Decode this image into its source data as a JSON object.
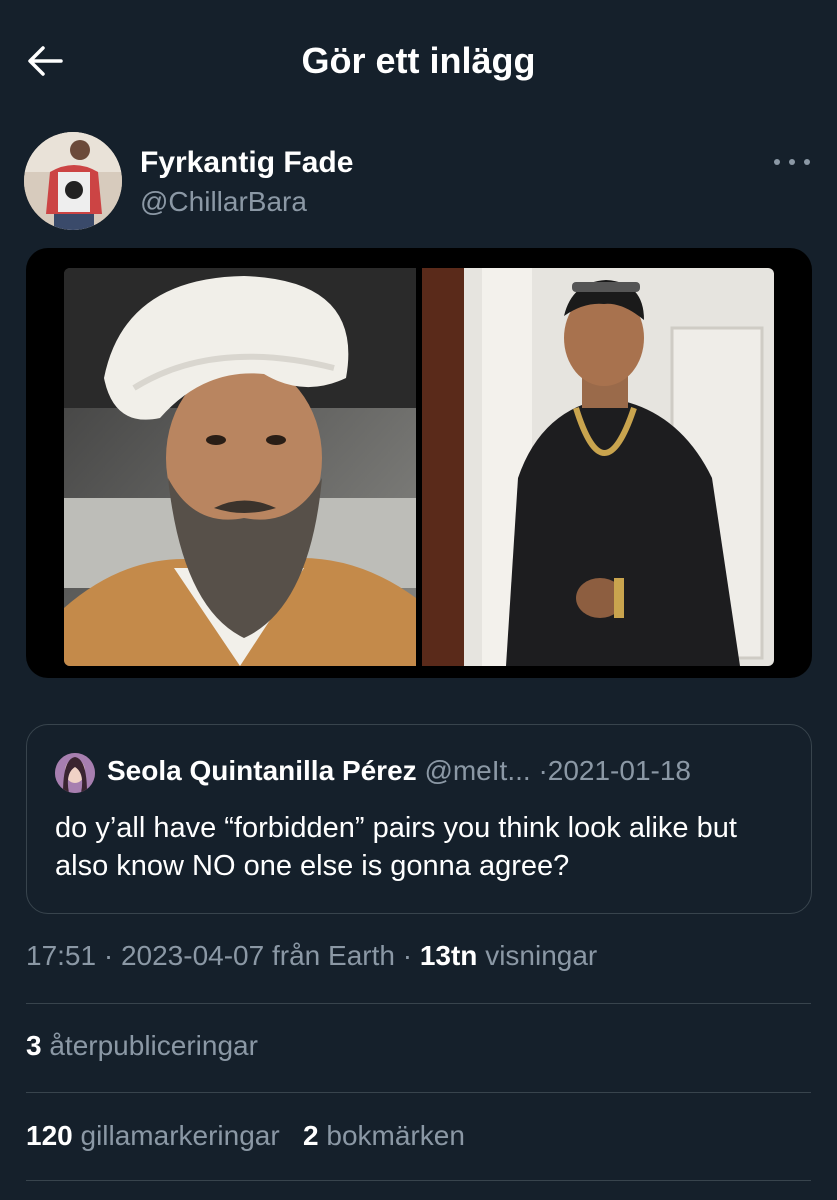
{
  "header": {
    "title": "Gör ett inlägg",
    "back_icon": "arrow-left-icon"
  },
  "author": {
    "name": "Fyrkantig Fade",
    "handle": "@ChillarBara"
  },
  "quoted_tweet": {
    "name": "Seola Quintanilla Pérez",
    "handle": "@meIt...",
    "separator": "·",
    "date": "2021-01-18",
    "text": "do y’all have “forbidden” pairs you think look alike but also know NO one else is gonna agree?"
  },
  "tweet_meta": {
    "time": "17:51",
    "sep1": "·",
    "date": "2023-04-07",
    "source": "från Earth",
    "sep2": "·",
    "views_count": "13tn",
    "views_label": "visningar"
  },
  "stats": {
    "retweets_count": "3",
    "retweets_label": "återpubliceringar",
    "likes_count": "120",
    "likes_label": "gillamarkeringar",
    "bookmarks_count": "2",
    "bookmarks_label": "bokmärken"
  },
  "colors": {
    "background": "#15202b",
    "secondary_text": "#8b98a5",
    "border": "#38444d"
  }
}
